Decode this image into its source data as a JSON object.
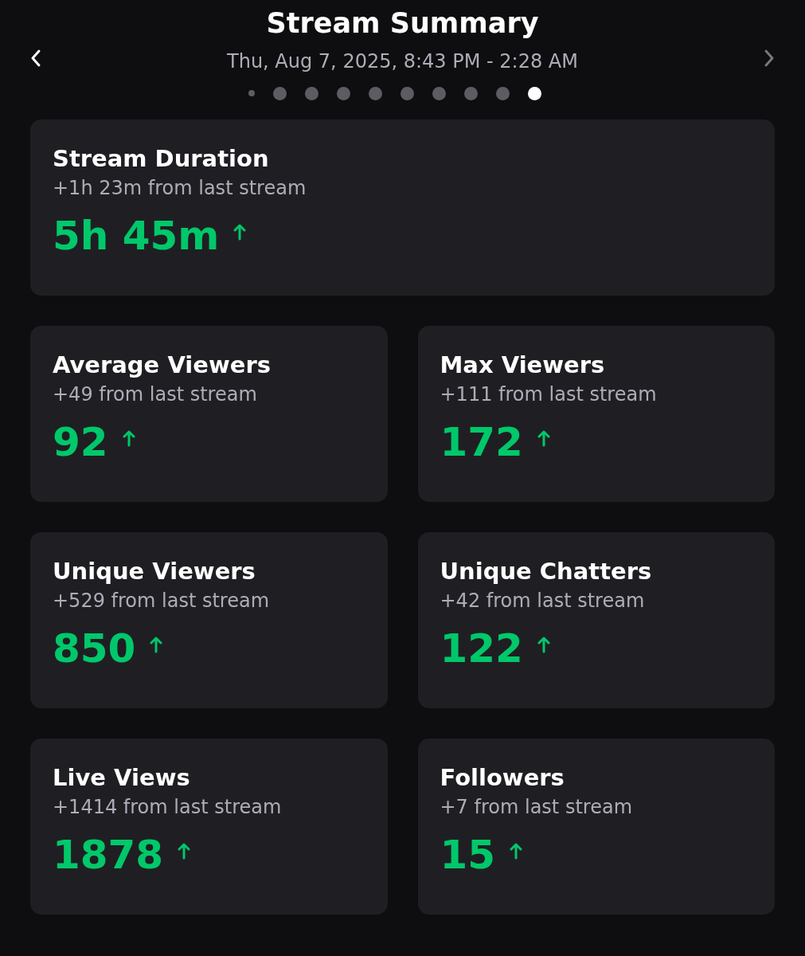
{
  "header": {
    "title": "Stream Summary",
    "subtitle": "Thu, Aug 7, 2025, 8:43 PM - 2:28 AM",
    "prev_disabled": false,
    "next_disabled": true
  },
  "pager": [
    {
      "kind": "small",
      "selected": false
    },
    {
      "kind": "normal",
      "selected": false
    },
    {
      "kind": "normal",
      "selected": false
    },
    {
      "kind": "normal",
      "selected": false
    },
    {
      "kind": "normal",
      "selected": false
    },
    {
      "kind": "normal",
      "selected": false
    },
    {
      "kind": "normal",
      "selected": false
    },
    {
      "kind": "normal",
      "selected": false
    },
    {
      "kind": "normal",
      "selected": false
    },
    {
      "kind": "normal",
      "selected": true
    }
  ],
  "cards": [
    {
      "title": "Stream Duration",
      "change": "+1h 23m from last stream",
      "value": "5h 45m",
      "rising": true,
      "wide": true
    },
    {
      "title": "Average Viewers",
      "change": "+49 from last stream",
      "value": "92",
      "rising": true,
      "wide": false
    },
    {
      "title": "Max Viewers",
      "change": "+111 from last stream",
      "value": "172",
      "rising": true,
      "wide": false
    },
    {
      "title": "Unique Viewers",
      "change": "+529 from last stream",
      "value": "850",
      "rising": true,
      "wide": false
    },
    {
      "title": "Unique Chatters",
      "change": "+42 from last stream",
      "value": "122",
      "rising": true,
      "wide": false
    },
    {
      "title": "Live Views",
      "change": "+1414 from last stream",
      "value": "1878",
      "rising": true,
      "wide": false
    },
    {
      "title": "Followers",
      "change": "+7 from last stream",
      "value": "15",
      "rising": true,
      "wide": false
    }
  ]
}
